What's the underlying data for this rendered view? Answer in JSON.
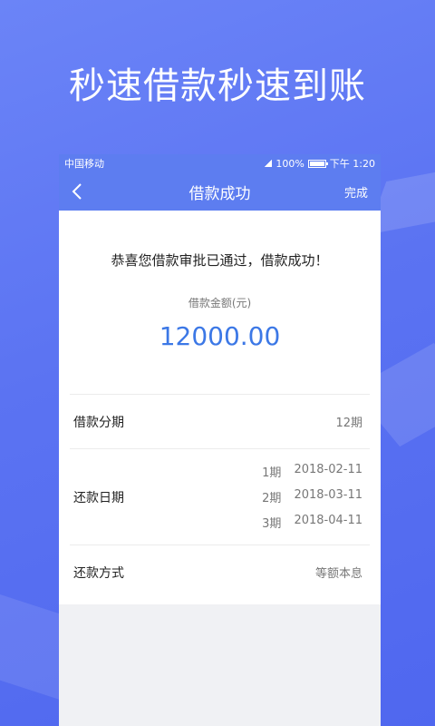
{
  "headline": "秒速借款秒速到账",
  "status_bar": {
    "carrier": "中国移动",
    "battery": "100%",
    "time": "下午 1:20"
  },
  "navbar": {
    "title": "借款成功",
    "done_label": "完成",
    "back_icon": "chevron-left-icon"
  },
  "result": {
    "message": "恭喜您借款审批已通过，借款成功！",
    "amount_label": "借款金额(元)",
    "amount": "12000.00"
  },
  "details": {
    "installments_label": "借款分期",
    "installments_value": "12期",
    "repay_date_label": "还款日期",
    "schedule": [
      {
        "period": "1期",
        "date": "2018-02-11"
      },
      {
        "period": "2期",
        "date": "2018-03-11"
      },
      {
        "period": "3期",
        "date": "2018-04-11"
      }
    ],
    "repay_method_label": "还款方式",
    "repay_method_value": "等额本息"
  },
  "colors": {
    "brand_blue": "#5d7df0",
    "amount_blue": "#3c78e6"
  }
}
